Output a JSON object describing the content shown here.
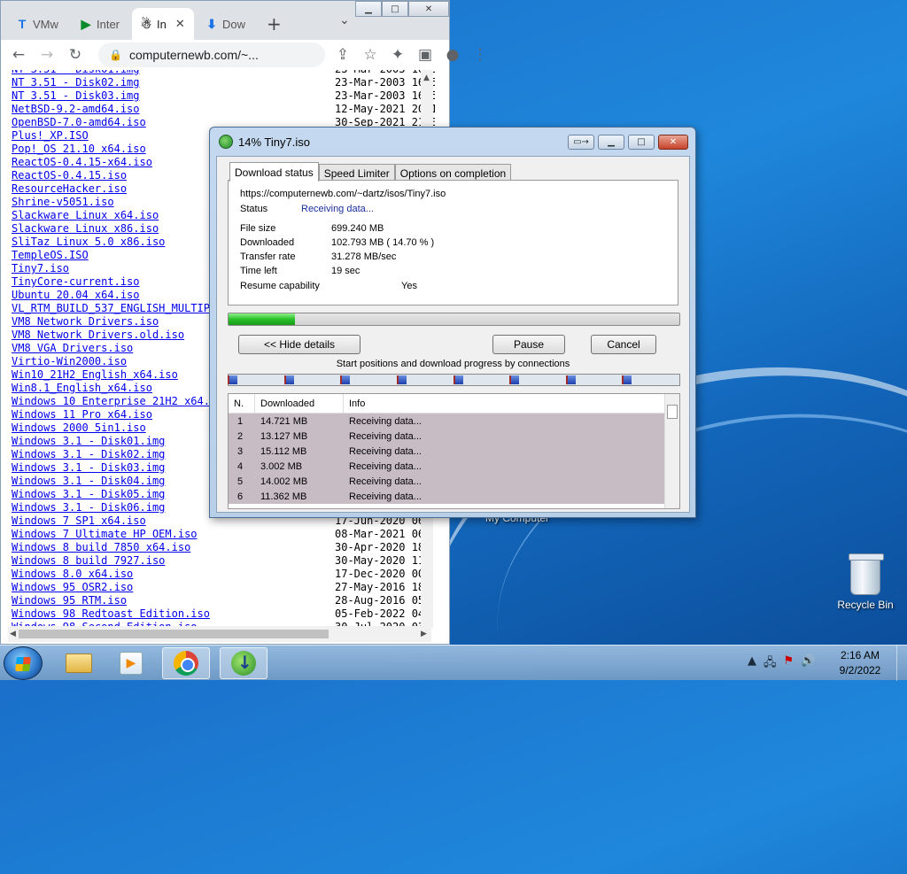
{
  "browser": {
    "tabs": [
      {
        "label": "VMw",
        "icon": "T",
        "color": "#1a73e8"
      },
      {
        "label": "Inter",
        "icon": "▶",
        "color": "#0a8a2a"
      },
      {
        "label": "In",
        "icon": "☃",
        "color": "#333"
      },
      {
        "label": "Dow",
        "icon": "⬇",
        "color": "#1a73e8"
      }
    ],
    "url": "computernewb.com/~..."
  },
  "files": [
    {
      "name": "NT 3.51 - Disk01.img",
      "date": "23-Mar-2003 16:5"
    },
    {
      "name": "NT 3.51 - Disk02.img",
      "date": "23-Mar-2003 16:5"
    },
    {
      "name": "NT 3.51 - Disk03.img",
      "date": "23-Mar-2003 16:5"
    },
    {
      "name": "NetBSD-9.2-amd64.iso",
      "date": "12-May-2021 20:1"
    },
    {
      "name": "OpenBSD-7.0-amd64.iso",
      "date": "30-Sep-2021 21:0"
    },
    {
      "name": "Plus!_XP.ISO",
      "date": ""
    },
    {
      "name": "Pop!_OS 21.10 x64.iso",
      "date": ""
    },
    {
      "name": "ReactOS-0.4.15-x64.iso",
      "date": ""
    },
    {
      "name": "ReactOS-0.4.15.iso",
      "date": ""
    },
    {
      "name": "ResourceHacker.iso",
      "date": ""
    },
    {
      "name": "Shrine-v5051.iso",
      "date": ""
    },
    {
      "name": "Slackware Linux x64.iso",
      "date": ""
    },
    {
      "name": "Slackware Linux x86.iso",
      "date": ""
    },
    {
      "name": "SliTaz Linux 5.0 x86.iso",
      "date": ""
    },
    {
      "name": "TempleOS.ISO",
      "date": ""
    },
    {
      "name": "Tiny7.iso",
      "date": ""
    },
    {
      "name": "TinyCore-current.iso",
      "date": ""
    },
    {
      "name": "Ubuntu 20.04 x64.iso",
      "date": ""
    },
    {
      "name": "VL_RTM_BUILD_537_ENGLISH_MULTIPO",
      "date": ""
    },
    {
      "name": "VM8 Network Drivers.iso",
      "date": ""
    },
    {
      "name": "VM8 Network Drivers.old.iso",
      "date": ""
    },
    {
      "name": "VM8 VGA Drivers.iso",
      "date": ""
    },
    {
      "name": "Virtio-Win2000.iso",
      "date": ""
    },
    {
      "name": "Win10_21H2_English_x64.iso",
      "date": ""
    },
    {
      "name": "Win8.1_English_x64.iso",
      "date": ""
    },
    {
      "name": "Windows 10 Enterprise 21H2 x64.i",
      "date": ""
    },
    {
      "name": "Windows 11 Pro x64.iso",
      "date": ""
    },
    {
      "name": "Windows 2000 5in1.iso",
      "date": ""
    },
    {
      "name": "Windows 3.1 - Disk01.img",
      "date": ""
    },
    {
      "name": "Windows 3.1 - Disk02.img",
      "date": ""
    },
    {
      "name": "Windows 3.1 - Disk03.img",
      "date": ""
    },
    {
      "name": "Windows 3.1 - Disk04.img",
      "date": ""
    },
    {
      "name": "Windows 3.1 - Disk05.img",
      "date": ""
    },
    {
      "name": "Windows 3.1 - Disk06.img",
      "date": ""
    },
    {
      "name": "Windows 7 SP1 x64.iso",
      "date": "17-Jun-2020 06:"
    },
    {
      "name": "Windows 7 Ultimate HP OEM.iso",
      "date": "08-Mar-2021 06:"
    },
    {
      "name": "Windows 8 build 7850 x64.iso",
      "date": "30-Apr-2020 18:"
    },
    {
      "name": "Windows 8 build 7927.iso",
      "date": "30-May-2020 11:"
    },
    {
      "name": "Windows 8.0 x64.iso",
      "date": "17-Dec-2020 00:"
    },
    {
      "name": "Windows 95 OSR2.iso",
      "date": "27-May-2016 18:"
    },
    {
      "name": "Windows 95 RTM.iso",
      "date": "28-Aug-2016 05:"
    },
    {
      "name": "Windows 98 Redtoast Edition.iso",
      "date": "05-Feb-2022 04:"
    },
    {
      "name": "Windows 98 Second Edition.iso",
      "date": "30-Jul-2020 03:"
    }
  ],
  "dialog": {
    "title": "14% Tiny7.iso",
    "tabs": [
      "Download status",
      "Speed Limiter",
      "Options on completion"
    ],
    "url": "https://computernewb.com/~dartz/isos/Tiny7.iso",
    "status_label": "Status",
    "status_value": "Receiving data...",
    "file_size_label": "File size",
    "file_size": "699.240  MB",
    "downloaded_label": "Downloaded",
    "downloaded": "102.793  MB  ( 14.70 % )",
    "rate_label": "Transfer rate",
    "rate": "31.278  MB/sec",
    "time_label": "Time left",
    "time_left": "19 sec",
    "resume_label": "Resume capability",
    "resume": "Yes",
    "progress": 0.147,
    "hide_details": "<< Hide details",
    "pause": "Pause",
    "cancel": "Cancel",
    "connections_label": "Start positions and download progress by connections",
    "connection_starts": [
      0.0,
      0.125,
      0.25,
      0.375,
      0.5,
      0.625,
      0.75,
      0.875
    ],
    "grid_headers": [
      "N.",
      "Downloaded",
      "Info"
    ],
    "connections": [
      {
        "n": "1",
        "downloaded": "14.721  MB",
        "info": "Receiving data..."
      },
      {
        "n": "2",
        "downloaded": "13.127  MB",
        "info": "Receiving data..."
      },
      {
        "n": "3",
        "downloaded": "15.112  MB",
        "info": "Receiving data..."
      },
      {
        "n": "4",
        "downloaded": "3.002  MB",
        "info": "Receiving data..."
      },
      {
        "n": "5",
        "downloaded": "14.002  MB",
        "info": "Receiving data..."
      },
      {
        "n": "6",
        "downloaded": "11.362  MB",
        "info": "Receiving data..."
      }
    ]
  },
  "desktop": {
    "my_computer": "My Computer",
    "recycle_bin": "Recycle Bin"
  },
  "taskbar": {
    "time": "2:16 AM",
    "date": "9/2/2022"
  }
}
